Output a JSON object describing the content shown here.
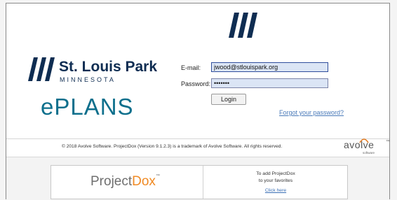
{
  "brand": {
    "name": "St. Louis Park",
    "state": "MINNESOTA",
    "product": "ePLANS"
  },
  "login_form": {
    "email_label": "E-mail:",
    "email_value": "jwood@stlouispark.org",
    "password_label": "Password:",
    "password_value": "•••••••",
    "login_label": "Login",
    "forgot_label": "Forgot your password?"
  },
  "footer": {
    "copyright": "© 2018 Avolve Software. ProjectDox (Version 9.1.2.3) is a trademark of Avolve Software. All rights reserved.",
    "avolve_word": "avolve",
    "avolve_sub": "software",
    "avolve_tm": "™"
  },
  "projectdox": {
    "logo_project": "Project",
    "logo_dox": "Dox",
    "logo_tm": "™",
    "fav_line1": "To add ProjectDox",
    "fav_line2": "to your favorites",
    "click_label": "Click here"
  },
  "colors": {
    "brand_navy": "#0f2d52",
    "eplans_teal": "#0d6f8c",
    "link_blue": "#4a7ab9",
    "field_bg": "#dbe5f5",
    "dox_orange": "#f08a24"
  }
}
